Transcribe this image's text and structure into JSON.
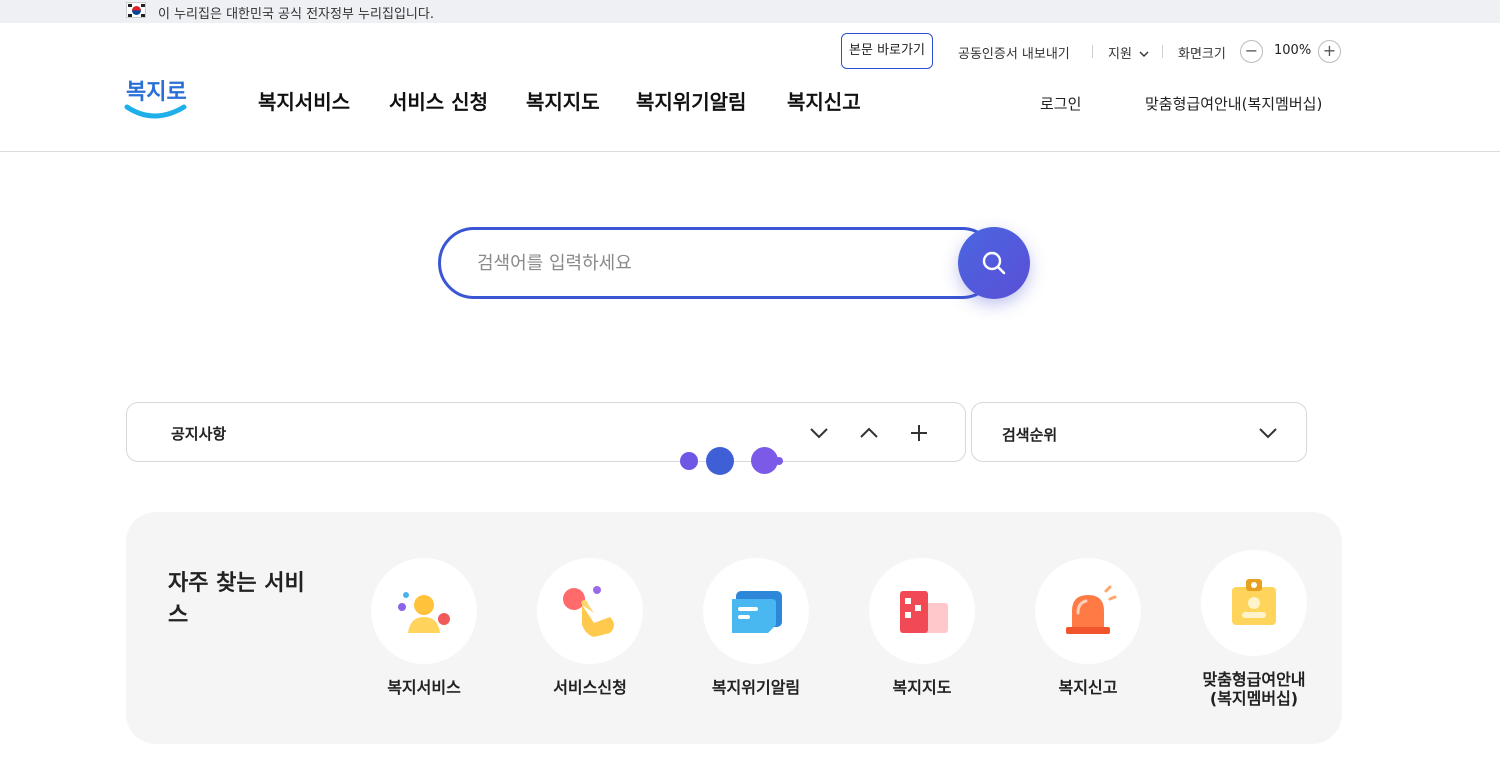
{
  "gov_banner": {
    "text": "이 누리집은 대한민국 공식 전자정부 누리집입니다."
  },
  "header": {
    "skip_link": "본문 바로가기",
    "cert_export": "공동인증서 내보내기",
    "support": "지원",
    "screen_size_label": "화면크기",
    "zoom_out": "−",
    "zoom_value": "100%",
    "zoom_in": "+",
    "logo_text": "복지로",
    "nav": [
      "복지서비스",
      "서비스 신청",
      "복지지도",
      "복지위기알림",
      "복지신고"
    ],
    "login": "로그인",
    "membership": "맞춤형급여안내(복지멤버십)"
  },
  "search": {
    "placeholder": "검색어를 입력하세요",
    "value": ""
  },
  "notice": {
    "title": "공지사항"
  },
  "rank": {
    "title": "검색순위"
  },
  "frequent": {
    "title": "자주 찾는 서비스",
    "items": [
      {
        "label": "복지서비스",
        "icon": "person-icon"
      },
      {
        "label": "서비스신청",
        "icon": "hand-tap-icon"
      },
      {
        "label": "복지위기알림",
        "icon": "message-icon"
      },
      {
        "label": "복지지도",
        "icon": "building-icon"
      },
      {
        "label": "복지신고",
        "icon": "siren-icon"
      },
      {
        "label": "맞춤형급여안내\n(복지멤버십)",
        "icon": "id-badge-icon"
      }
    ]
  },
  "colors": {
    "accent": "#3a56d4",
    "panel_bg": "#f5f5f5"
  }
}
